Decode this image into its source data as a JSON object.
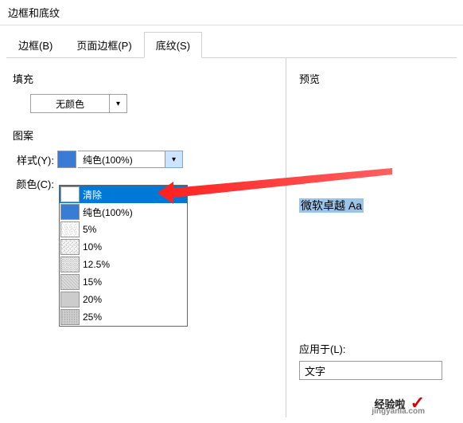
{
  "title": "边框和底纹",
  "tabs": {
    "border": "边框(B)",
    "page_border": "页面边框(P)",
    "shading": "底纹(S)"
  },
  "fill": {
    "label": "填充",
    "value": "无颜色"
  },
  "pattern": {
    "label": "图案",
    "style_label": "样式(Y):",
    "style_value": "纯色(100%)",
    "color_label": "颜色(C):"
  },
  "dropdown": {
    "items": [
      {
        "label": "清除",
        "swatch": "sw-clear",
        "hl": true
      },
      {
        "label": "纯色(100%)",
        "swatch": "sw-solid"
      },
      {
        "label": "5%",
        "swatch": "sw-p5"
      },
      {
        "label": "10%",
        "swatch": "sw-p10"
      },
      {
        "label": "12.5%",
        "swatch": "sw-p12"
      },
      {
        "label": "15%",
        "swatch": "sw-p15"
      },
      {
        "label": "20%",
        "swatch": "sw-p20"
      },
      {
        "label": "25%",
        "swatch": "sw-p25"
      }
    ]
  },
  "preview": {
    "label": "预览",
    "text": "微软卓越  Aa"
  },
  "apply": {
    "label": "应用于(L):",
    "value": "文字"
  },
  "watermark": {
    "brand": "经验啦",
    "url": "jingyanla.com",
    "check": "✓"
  },
  "icons": {
    "down": "▾"
  }
}
